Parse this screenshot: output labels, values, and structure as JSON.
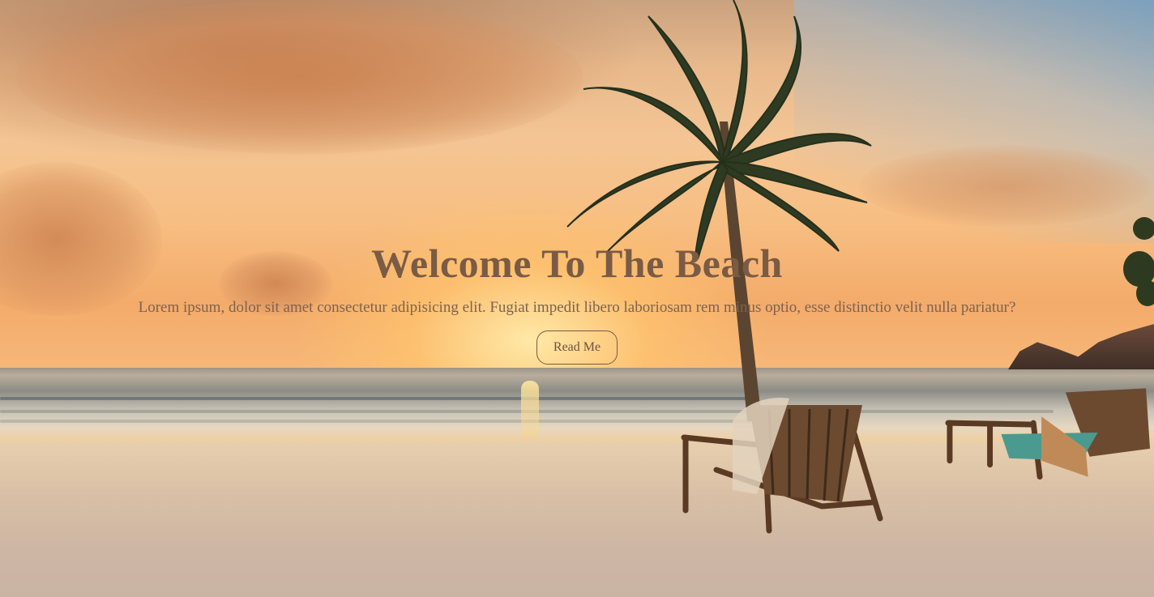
{
  "hero": {
    "title": "Welcome To The Beach",
    "subtitle": "Lorem ipsum, dolor sit amet consectetur adipisicing elit. Fugiat impedit libero laboriosam rem minus optio, esse distinctio velit nulla pariatur?",
    "button_label": "Read Me"
  },
  "colors": {
    "text": "#7a5b44",
    "sky_warm": "#f4c594",
    "sand": "#d9bfa5"
  },
  "background": {
    "icon": "beach-sunset-scene"
  }
}
